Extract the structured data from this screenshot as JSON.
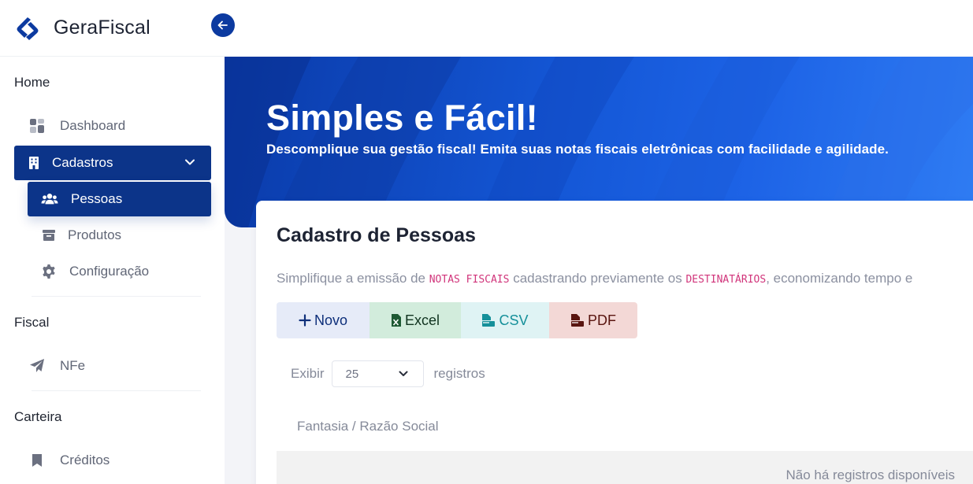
{
  "brand": {
    "name": "GeraFiscal",
    "logo_icon": "gerafiscal-logo-icon"
  },
  "colors": {
    "primary": "#0c3489",
    "hero_start": "#0a3aa8",
    "hero_end": "#2f7cf3"
  },
  "sidebar": {
    "sections": {
      "home": "Home",
      "fiscal": "Fiscal",
      "carteira": "Carteira"
    },
    "items": {
      "dashboard": "Dashboard",
      "cadastros": "Cadastros",
      "pessoas": "Pessoas",
      "produtos": "Produtos",
      "configuracao": "Configuração",
      "nfe": "NFe",
      "creditos": "Créditos"
    }
  },
  "hero": {
    "title": "Simples e Fácil!",
    "subtitle": "Descomplique sua gestão fiscal! Emita suas notas fiscais eletrônicas com facilidade e agilidade."
  },
  "card": {
    "title": "Cadastro de Pessoas",
    "desc_part1": "Simplifique a emissão de ",
    "desc_code1": "NOTAS FISCAIS",
    "desc_part2": " cadastrando previamente os ",
    "desc_code2": "DESTINATÁRIOS",
    "desc_part3": ", economizando tempo e",
    "buttons": {
      "novo": "Novo",
      "excel": "Excel",
      "csv": "CSV",
      "pdf": "PDF"
    },
    "length": {
      "before": "Exibir",
      "value": "25",
      "after": "registros"
    },
    "table": {
      "column": "Fantasia / Razão Social",
      "empty": "Não há registros disponíveis"
    }
  }
}
